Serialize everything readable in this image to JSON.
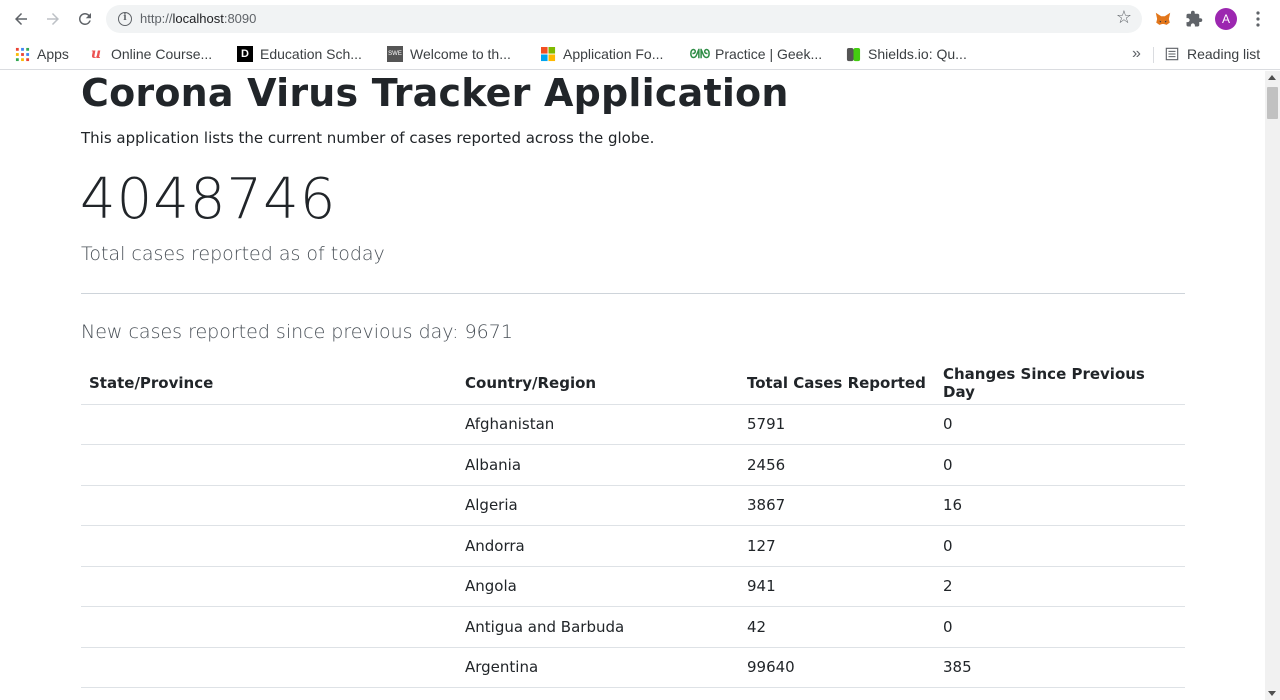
{
  "browser": {
    "url_scheme": "http://",
    "url_host": "localhost",
    "url_port": ":8090",
    "avatar_letter": "A",
    "colors": {
      "avatar": "#9c27b0",
      "toolbar": "#ffffff",
      "omnibox": "#f1f3f4"
    }
  },
  "bookmarks": {
    "apps_label": "Apps",
    "items": [
      {
        "label": "Online Course...",
        "icon": "udemy-icon"
      },
      {
        "label": "Education Sch...",
        "icon": "dev-d-icon"
      },
      {
        "label": "Welcome to th...",
        "icon": "swe-icon"
      },
      {
        "label": "Application Fo...",
        "icon": "microsoft-icon"
      },
      {
        "label": "Practice | Geek...",
        "icon": "geeksforgeeks-icon"
      },
      {
        "label": "Shields.io: Qu...",
        "icon": "shields-icon"
      }
    ],
    "more_label": "»",
    "reading_list_label": "Reading list"
  },
  "page": {
    "title": "Corona Virus Tracker Application",
    "subtitle": "This application lists the current number of cases reported across the globe.",
    "total_cases": "4048746",
    "total_caption": "Total cases reported as of today",
    "new_cases_text": "New cases reported since previous day: 9671"
  },
  "table": {
    "headers": [
      "State/Province",
      "Country/Region",
      "Total Cases Reported",
      "Changes Since Previous Day"
    ],
    "rows": [
      {
        "state": "",
        "country": "Afghanistan",
        "total": "5791",
        "change": "0"
      },
      {
        "state": "",
        "country": "Albania",
        "total": "2456",
        "change": "0"
      },
      {
        "state": "",
        "country": "Algeria",
        "total": "3867",
        "change": "16"
      },
      {
        "state": "",
        "country": "Andorra",
        "total": "127",
        "change": "0"
      },
      {
        "state": "",
        "country": "Angola",
        "total": "941",
        "change": "2"
      },
      {
        "state": "",
        "country": "Antigua and Barbuda",
        "total": "42",
        "change": "0"
      },
      {
        "state": "",
        "country": "Argentina",
        "total": "99640",
        "change": "385"
      }
    ]
  }
}
